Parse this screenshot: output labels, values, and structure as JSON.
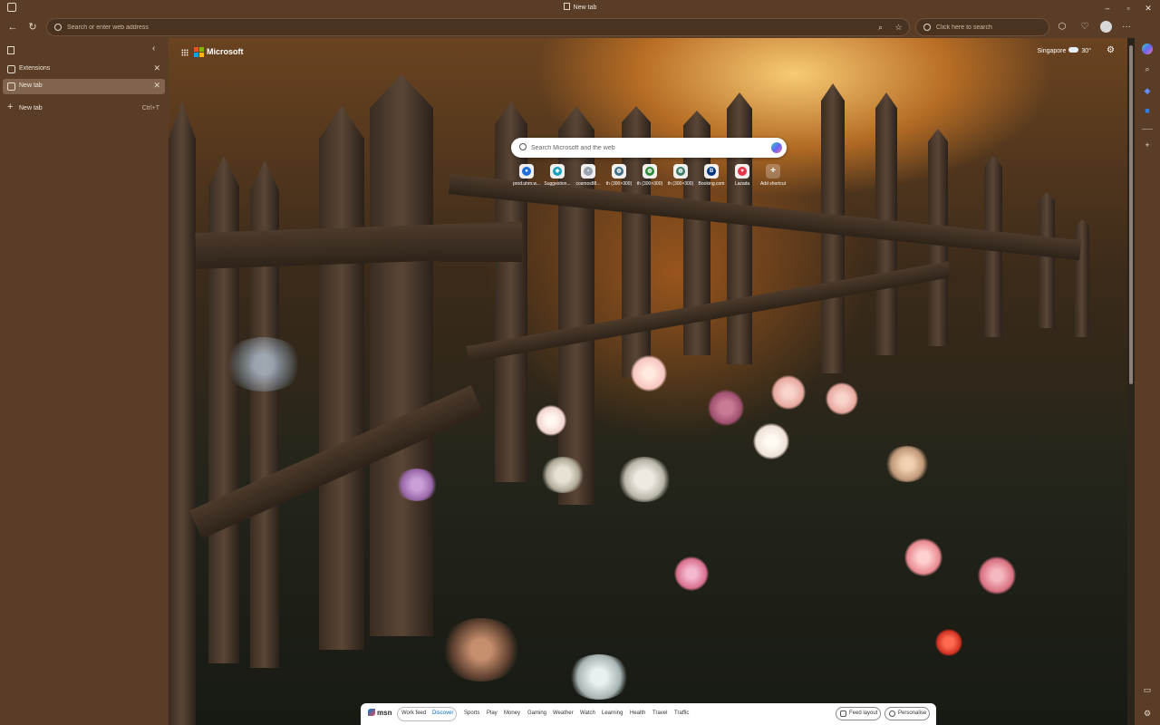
{
  "window": {
    "title": "New tab",
    "controls": {
      "minimize": "–",
      "maximize": "▫",
      "close": "✕"
    }
  },
  "toolbar": {
    "address_placeholder": "Search or enter web address",
    "bing_placeholder": "Click here to search",
    "back_glyph": "←",
    "refresh_glyph": "↻",
    "more_glyph": "···"
  },
  "sidebar": {
    "collapse_glyph": "‹",
    "tabs": [
      {
        "label": "Extensions",
        "close": "✕"
      },
      {
        "label": "New tab",
        "close": "✕"
      }
    ],
    "new_tab": {
      "label": "New tab",
      "shortcut": "Ctrl+T",
      "plus": "+"
    }
  },
  "ntp": {
    "brand": "Microsoft",
    "weather": {
      "city": "Singapore",
      "temp": "30°"
    },
    "settings_glyph": "⚙",
    "search_placeholder": "Search Microsoft and the web",
    "shortcuts": [
      {
        "label": "prod.uhm.w...",
        "color": "#1e6fd9",
        "glyph": "●"
      },
      {
        "label": "Suggestion...",
        "color": "#1aa3c2",
        "glyph": "◆"
      },
      {
        "label": "cosmos88...",
        "color": "#9aa4b0",
        "glyph": "▪"
      },
      {
        "label": "th (300×300)",
        "color": "#3d6f8a",
        "glyph": "◍"
      },
      {
        "label": "th (300×300)",
        "color": "#2f8a3a",
        "glyph": "◍"
      },
      {
        "label": "th (300×300)",
        "color": "#3d7d6a",
        "glyph": "◍"
      },
      {
        "label": "Booking.com",
        "color": "#003580",
        "glyph": "B"
      },
      {
        "label": "Lazada",
        "color": "#e8344a",
        "glyph": "♥"
      },
      {
        "label": "Add shortcut",
        "color": "#ffffff",
        "glyph": "+"
      }
    ]
  },
  "msn": {
    "logo": "msn",
    "items": [
      "Work feed",
      "Discover",
      "Sports",
      "Play",
      "Money",
      "Gaming",
      "Weather",
      "Watch",
      "Learning",
      "Health",
      "Travel",
      "Traffic"
    ],
    "selected": "Discover",
    "feed_layout": "Feed layout",
    "personalise": "Personalise"
  },
  "right_rail": {
    "search_glyph": "⌕",
    "add_glyph": "+",
    "settings_glyph": "⚙",
    "screen_glyph": "▭"
  }
}
